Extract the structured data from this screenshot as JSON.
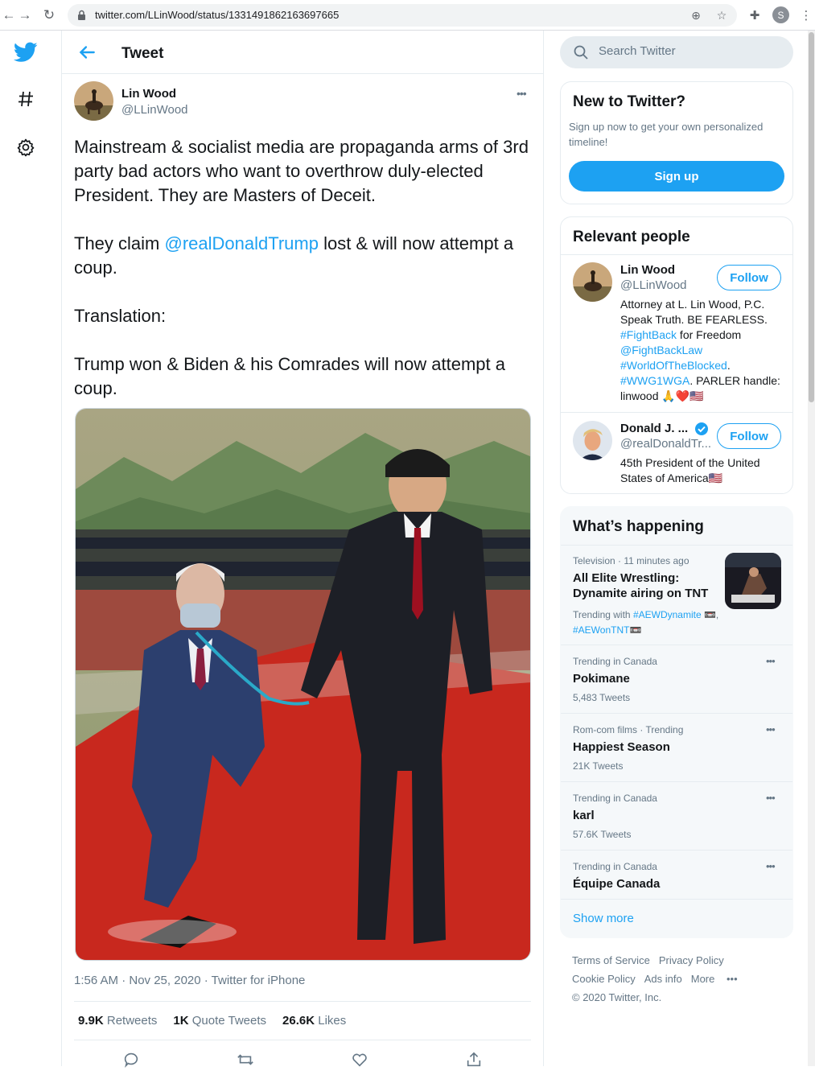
{
  "browser": {
    "url": "twitter.com/LLinWood/status/1331491862163697665",
    "profile_initial": "S"
  },
  "header": {
    "title": "Tweet"
  },
  "tweet": {
    "author_name": "Lin Wood",
    "author_handle": "@LLinWood",
    "paragraph1": "Mainstream & socialist media are propaganda arms of 3rd party bad actors who want to overthrow duly-elected President. They are Masters of Deceit.",
    "paragraph2_before": "They claim ",
    "paragraph2_mention": "@realDonaldTrump",
    "paragraph2_after": " lost & will now attempt a coup.",
    "paragraph3": "Translation:",
    "paragraph4": "Trump won & Biden & his Comrades will now attempt a coup.",
    "meta": "1:56 AM · Nov 25, 2020 · Twitter for iPhone",
    "retweets_count": "9.9K",
    "retweets_label": "Retweets",
    "quotes_count": "1K",
    "quotes_label": "Quote Tweets",
    "likes_count": "26.6K",
    "likes_label": "Likes"
  },
  "search": {
    "placeholder": "Search Twitter"
  },
  "new_to_twitter": {
    "title": "New to Twitter?",
    "text": "Sign up now to get your own personalized timeline!",
    "button": "Sign up"
  },
  "relevant_people": {
    "title": "Relevant people",
    "people": [
      {
        "name": "Lin Wood",
        "handle": "@LLinWood",
        "follow": "Follow",
        "bio_text": "Attorney at L. Lin Wood, P.C. Speak Truth. BE FEARLESS. ",
        "bio_tag1": "#FightBack",
        "bio_mid": " for Freedom ",
        "bio_tag2": "@FightBackLaw",
        "bio_tag3": "#WorldOfTheBlocked",
        "bio_dot": ".",
        "bio_tag4": "#WWG1WGA",
        "bio_end": ". PARLER handle: linwood 🙏❤️🇺🇸"
      },
      {
        "name": "Donald J. ...",
        "handle": "@realDonaldTr...",
        "follow": "Follow",
        "bio_text": "45th President of the United States of America🇺🇸"
      }
    ]
  },
  "whats_happening": {
    "title": "What’s happening",
    "trends": [
      {
        "meta": "Television · 11 minutes ago",
        "name": "All Elite Wrestling: Dynamite airing on TNT",
        "trending_with_label": "Trending with ",
        "tag1": "#AEWDynamite",
        "tag2": "#AEWonTNT"
      },
      {
        "meta": "Trending in Canada",
        "name": "Pokimane",
        "count": "5,483 Tweets"
      },
      {
        "meta": "Rom-com films · Trending",
        "name": "Happiest Season",
        "count": "21K Tweets"
      },
      {
        "meta": "Trending in Canada",
        "name": "karl",
        "count": "57.6K Tweets"
      },
      {
        "meta": "Trending in Canada",
        "name": "Équipe Canada"
      }
    ],
    "show_more": "Show more"
  },
  "footer": {
    "terms": "Terms of Service",
    "privacy": "Privacy Policy",
    "cookie": "Cookie Policy",
    "ads": "Ads info",
    "more": "More",
    "copyright": "© 2020 Twitter, Inc."
  },
  "colors": {
    "accent": "#1da1f2",
    "text": "#14171a",
    "muted": "#657786",
    "border": "#e6ecf0"
  },
  "icons": [
    "twitter-logo",
    "hashtag-icon",
    "gear-icon",
    "back-arrow-icon",
    "search-icon",
    "reply-icon",
    "retweet-icon",
    "like-icon",
    "share-icon"
  ]
}
